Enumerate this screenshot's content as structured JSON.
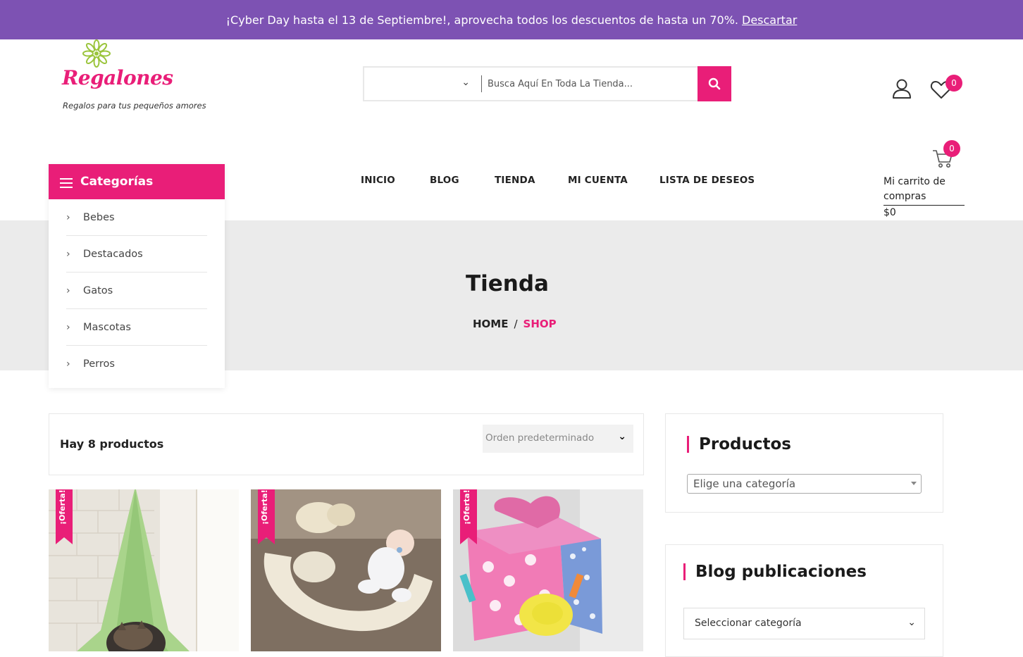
{
  "announcement": {
    "text": "¡Cyber Day hasta el 13 de Septiembre!, aprovecha todos los descuentos de hasta un 70%.",
    "dismiss_label": "Descartar"
  },
  "logo": {
    "name": "Regalones",
    "tagline": "Regalos para tus pequeños amores"
  },
  "search": {
    "category_value": "",
    "placeholder": "Busca Aquí En Toda La Tienda..."
  },
  "header": {
    "wishlist_count": "0",
    "cart_count": "0",
    "cart_label": "Mi carrito de compras",
    "cart_total": "$0"
  },
  "categories": {
    "title": "Categorías",
    "items": [
      {
        "label": "Bebes"
      },
      {
        "label": "Destacados"
      },
      {
        "label": "Gatos"
      },
      {
        "label": "Mascotas"
      },
      {
        "label": "Perros"
      }
    ]
  },
  "nav": {
    "items": [
      {
        "label": "INICIO"
      },
      {
        "label": "BLOG"
      },
      {
        "label": "TIENDA"
      },
      {
        "label": "MI CUENTA"
      },
      {
        "label": "LISTA DE DESEOS"
      }
    ]
  },
  "hero": {
    "title": "Tienda",
    "breadcrumb_home": "HOME",
    "breadcrumb_separator": "/",
    "breadcrumb_current": "SHOP"
  },
  "shop": {
    "product_count": "Hay 8 productos",
    "orderby_value": "Orden predeterminado"
  },
  "products": [
    {
      "sale_label": "¡Oferta!"
    },
    {
      "sale_label": "¡Oferta!"
    },
    {
      "sale_label": "¡Oferta!"
    }
  ],
  "sidebar": {
    "products_widget": {
      "title": "Productos",
      "select_value": "Elige una categoría"
    },
    "blog_widget": {
      "title": "Blog publicaciones",
      "select_value": "Seleccionar categoría"
    }
  },
  "colors": {
    "accent": "#e91e78",
    "announcement_bg": "#7d52b3",
    "hero_bg": "#ebebeb"
  }
}
